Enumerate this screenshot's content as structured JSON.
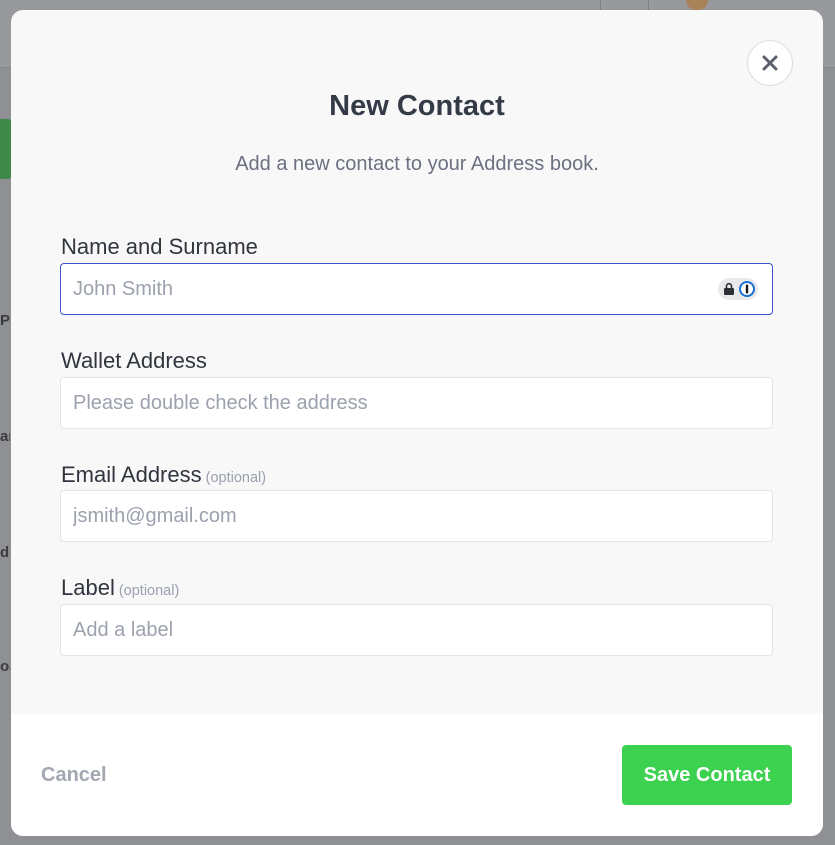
{
  "modal": {
    "title": "New Contact",
    "subtitle": "Add a new contact to your Address book.",
    "close_icon": "close-icon"
  },
  "form": {
    "name": {
      "label": "Name and Surname",
      "placeholder": "John Smith",
      "value": "",
      "password_manager_icon": "password-manager-icon"
    },
    "wallet": {
      "label": "Wallet Address",
      "placeholder": "Please double check the address",
      "value": ""
    },
    "email": {
      "label": "Email Address",
      "optional": "(optional)",
      "placeholder": "jsmith@gmail.com",
      "value": ""
    },
    "label": {
      "label": "Label",
      "optional": "(optional)",
      "placeholder": "Add a label",
      "value": ""
    }
  },
  "footer": {
    "cancel_label": "Cancel",
    "save_label": "Save Contact"
  },
  "colors": {
    "accent_green": "#3cd24f",
    "focus_blue": "#3a55c8",
    "title_text": "#343a46"
  }
}
